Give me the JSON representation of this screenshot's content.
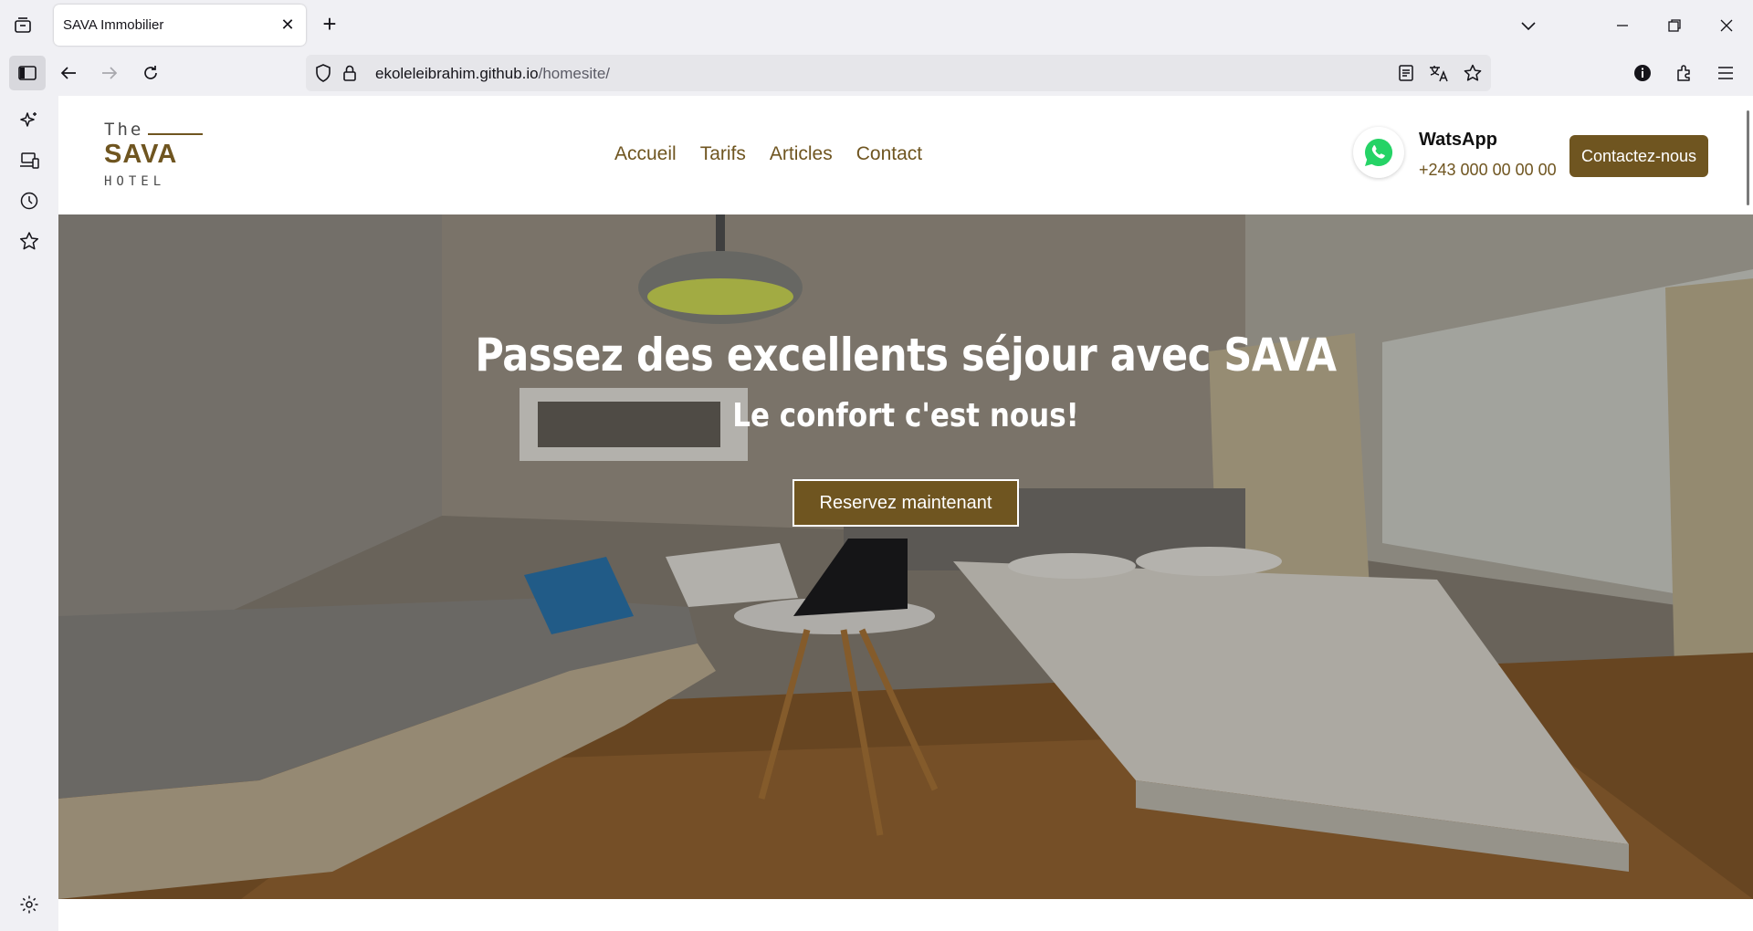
{
  "browser": {
    "tab_title": "SAVA Immobilier",
    "url_host": "ekoleleibrahim.github.io",
    "url_path": "/homesite/",
    "icons": [
      "tab-list-icon",
      "close-icon",
      "plus-icon",
      "chevron-down-icon",
      "minimize-icon",
      "restore-icon",
      "window-close-icon",
      "sidebar-icon",
      "back-arrow-icon",
      "forward-arrow-icon",
      "reload-icon",
      "shield-icon",
      "lock-icon",
      "reader-mode-icon",
      "translate-icon",
      "star-icon",
      "info-icon",
      "extensions-icon",
      "menu-icon",
      "ai-sparkle-icon",
      "synced-tabs-icon",
      "history-icon",
      "bookmarks-star-icon",
      "settings-gear-icon"
    ]
  },
  "site": {
    "logo": {
      "the": "The",
      "name": "SAVA",
      "sub": "HOTEL"
    },
    "nav": [
      "Accueil",
      "Tarifs",
      "Articles",
      "Contact"
    ],
    "whatsapp": {
      "title": "WatsApp",
      "phone": "+243 000 00 00 00"
    },
    "cta": "Contactez-nous",
    "hero": {
      "title": "Passez des excellents séjour avec SAVA",
      "subtitle": "Le confort c'est nous!",
      "button": "Reservez maintenant"
    },
    "colors": {
      "brand": "#6f5520",
      "whatsapp": "#25d366"
    }
  }
}
